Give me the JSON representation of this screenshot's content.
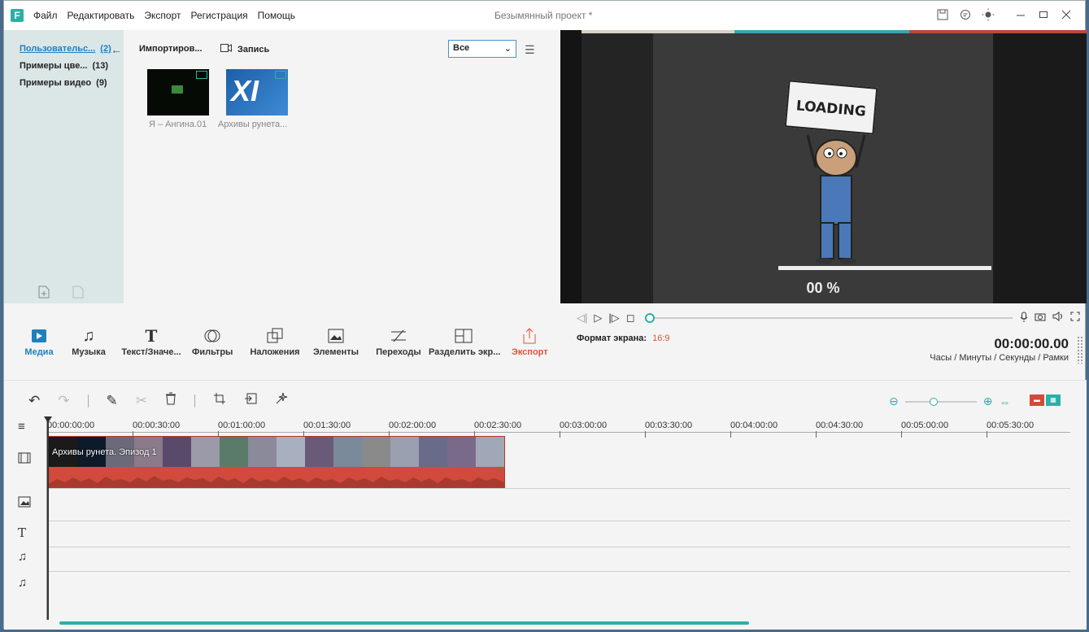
{
  "app": {
    "logo": "F",
    "document_title": "Безымянный проект *",
    "menu": [
      "Файл",
      "Редактировать",
      "Экспорт",
      "Регистрация",
      "Помощь"
    ]
  },
  "library": {
    "categories": [
      {
        "label": "Пользовательс...",
        "count": "(2)",
        "active": true
      },
      {
        "label": "Примеры цве...",
        "count": "(13)",
        "active": false
      },
      {
        "label": "Примеры видео",
        "count": "(9)",
        "active": false
      }
    ]
  },
  "media": {
    "import_label": "Импортиров...",
    "record_label": "Запись",
    "filter_value": "Все",
    "items": [
      {
        "label": "Я – Ангина.01"
      },
      {
        "label": "Архивы рунета..."
      }
    ]
  },
  "preview": {
    "sign_text": "LOADING",
    "percent_text": "00 %",
    "aspect_label": "Формат экрана:",
    "aspect_value": "16:9",
    "timecode": "00:00:00.00",
    "time_units": "Часы / Минуты / Секунды / Рамки",
    "progress": 0
  },
  "tools": [
    {
      "label": "Медиа",
      "icon": "play-box-icon",
      "active": true
    },
    {
      "label": "Музыка",
      "icon": "music-note-icon"
    },
    {
      "label": "Текст/Значе...",
      "icon": "text-icon"
    },
    {
      "label": "Фильтры",
      "icon": "filter-icon"
    },
    {
      "label": "Наложения",
      "icon": "overlay-icon"
    },
    {
      "label": "Элементы",
      "icon": "image-icon"
    },
    {
      "label": "Переходы",
      "icon": "transition-icon"
    },
    {
      "label": "Разделить экр...",
      "icon": "split-screen-icon"
    },
    {
      "label": "Экспорт",
      "icon": "export-icon",
      "export": true
    }
  ],
  "timeline": {
    "ruler": [
      "00:00:00:00",
      "00:00:30:00",
      "00:01:00:00",
      "00:01:30:00",
      "00:02:00:00",
      "00:02:30:00",
      "00:03:00:00",
      "00:03:30:00",
      "00:04:00:00",
      "00:04:30:00",
      "00:05:00:00",
      "00:05:30:00"
    ],
    "clip_title": "Архивы рунета. Эпизод 1",
    "zoom_level": 0.4,
    "colors": {
      "accent": "#2bb0a8",
      "clip": "#d14a3b",
      "active": "#1f7fbf",
      "export": "#e0533b"
    }
  }
}
